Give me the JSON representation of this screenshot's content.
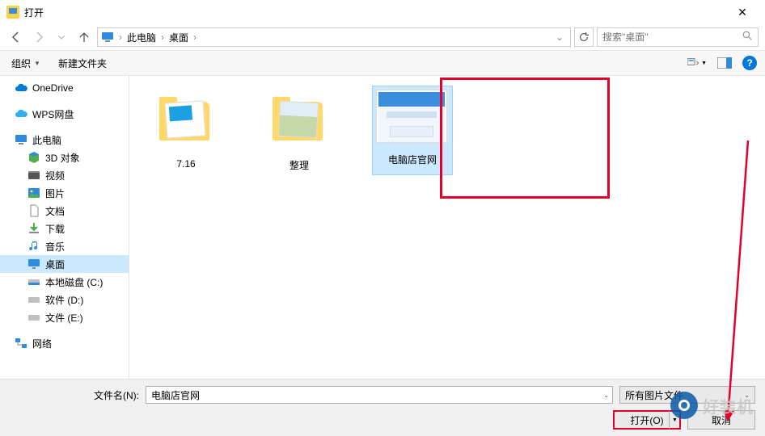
{
  "window": {
    "title": "打开"
  },
  "nav": {
    "path": [
      "此电脑",
      "桌面"
    ],
    "search_placeholder": "搜索\"桌面\""
  },
  "toolbar": {
    "organize": "组织",
    "new_folder": "新建文件夹"
  },
  "sidebar": {
    "onedrive": "OneDrive",
    "wps": "WPS网盘",
    "thispc": "此电脑",
    "items": [
      {
        "icon": "3d",
        "label": "3D 对象"
      },
      {
        "icon": "video",
        "label": "视频"
      },
      {
        "icon": "pictures",
        "label": "图片"
      },
      {
        "icon": "documents",
        "label": "文档"
      },
      {
        "icon": "downloads",
        "label": "下载"
      },
      {
        "icon": "music",
        "label": "音乐"
      },
      {
        "icon": "desktop",
        "label": "桌面"
      },
      {
        "icon": "drive",
        "label": "本地磁盘 (C:)"
      },
      {
        "icon": "drive",
        "label": "软件 (D:)"
      },
      {
        "icon": "drive",
        "label": "文件 (E:)"
      }
    ],
    "network": "网络"
  },
  "content": {
    "items": [
      {
        "type": "folder-doc",
        "name": "7.16"
      },
      {
        "type": "folder-photo",
        "name": "整理"
      },
      {
        "type": "image",
        "name": "电脑店官网",
        "selected": true
      }
    ]
  },
  "footer": {
    "filename_label": "文件名(N):",
    "filename_value": "电脑店官网",
    "filter_label": "所有图片文件",
    "open_btn": "打开(O)",
    "cancel_btn": "取消"
  },
  "watermark": "好装机"
}
